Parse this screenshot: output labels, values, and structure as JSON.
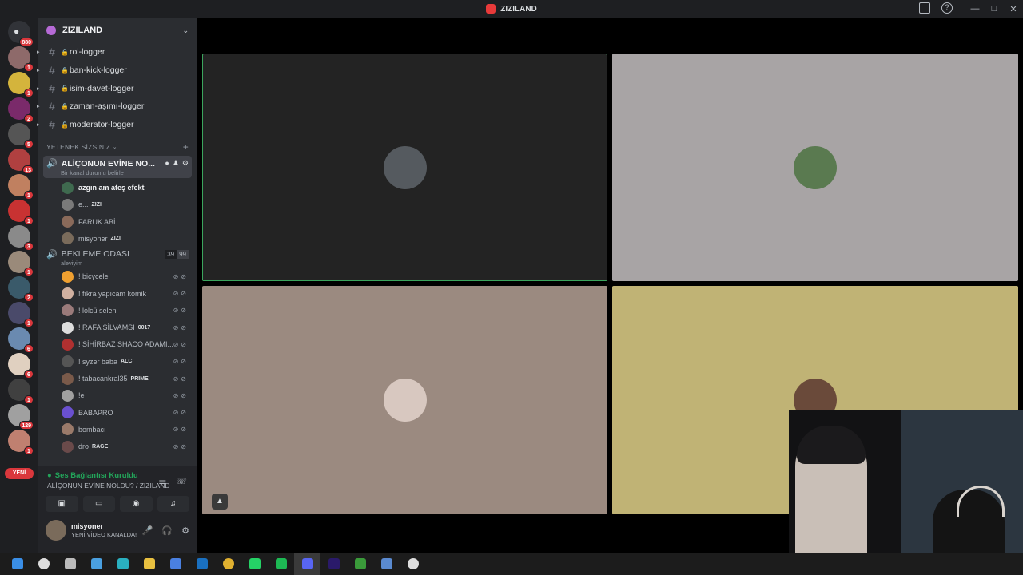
{
  "window": {
    "title": "ZIZILAND"
  },
  "guilds": {
    "home_badge": "880",
    "items": [
      {
        "color": "#8e6a6a",
        "badge": "1"
      },
      {
        "color": "#d4b43c",
        "badge": "1"
      },
      {
        "color": "#7a2a6a",
        "badge": "2"
      },
      {
        "color": "#555555",
        "badge": "5"
      },
      {
        "color": "#b04040",
        "badge": "13"
      },
      {
        "color": "#c08060",
        "badge": "1"
      },
      {
        "color": "#c83232",
        "badge": "1"
      },
      {
        "color": "#8a8a8a",
        "badge": "3"
      },
      {
        "color": "#9a8a7a",
        "badge": "1"
      },
      {
        "color": "#3a5a6a",
        "badge": "2"
      },
      {
        "color": "#4a4a6a",
        "badge": "1"
      },
      {
        "color": "#6a8ab0",
        "badge": "6"
      },
      {
        "color": "#e0d0c0",
        "badge": "6"
      },
      {
        "color": "#404040",
        "badge": "1"
      },
      {
        "color": "#a0a0a0",
        "badge": "129"
      },
      {
        "color": "#c08070",
        "badge": "1"
      }
    ],
    "new_label": "YENİ"
  },
  "server": {
    "name": "ZIZILAND",
    "text_channels": [
      {
        "name": "rol-logger"
      },
      {
        "name": "ban-kick-logger"
      },
      {
        "name": "isim-davet-logger"
      },
      {
        "name": "zaman-aşımı-logger"
      },
      {
        "name": "moderator-logger"
      }
    ],
    "category": "YETENEK SİZSİNİZ",
    "active_voice": {
      "name": "ALİÇONUN EVİNE NO...",
      "status": "Bir kanal durumu belirle",
      "users": [
        {
          "name": "azgın am ateş efekt",
          "tag": "",
          "color": "#3f6a4f"
        },
        {
          "name": "e...",
          "tag": "ZIZI",
          "color": "#7a7a7a"
        },
        {
          "name": "FARUK ABİ",
          "tag": "",
          "color": "#8a6a5a"
        },
        {
          "name": "misyoner",
          "tag": "ZIZI",
          "color": "#7a6b5b"
        }
      ]
    },
    "waiting_voice": {
      "name": "BEKLEME ODASI",
      "count_a": "39",
      "count_b": "99",
      "status": "aleviyim",
      "users": [
        {
          "name": "! bicycele",
          "tag": "",
          "color": "#f0a030"
        },
        {
          "name": "! fıkra yapıcam komik",
          "tag": "",
          "color": "#d0b0a0"
        },
        {
          "name": "! lolcü selen",
          "tag": "",
          "color": "#9a7a7a"
        },
        {
          "name": "! RAFA SİLVAMSI",
          "tag": "0017",
          "color": "#dddddd"
        },
        {
          "name": "! SİHİRBAZ SHACO ADAMI...",
          "tag": "",
          "color": "#b03030"
        },
        {
          "name": "! syzer baba",
          "tag": "ALC",
          "color": "#555555"
        },
        {
          "name": "! tabacankral35",
          "tag": "PRIME",
          "color": "#7a5a4a"
        },
        {
          "name": "!e",
          "tag": "",
          "color": "#a0a0a0"
        },
        {
          "name": "BABAPRO",
          "tag": "",
          "color": "#6a50d0"
        },
        {
          "name": "bombacı",
          "tag": "",
          "color": "#9a7a6a"
        },
        {
          "name": "dro",
          "tag": "RAGE",
          "color": "#6a4a4a"
        }
      ]
    }
  },
  "voice_panel": {
    "state": "Ses Bağlantısı Kuruldu",
    "location": "ALİÇONUN EVİNE NOLDU? / ZIZILAND"
  },
  "user_panel": {
    "name": "misyoner",
    "status": "YENİ VİDEO KANALDA!"
  },
  "tiles": [
    {
      "bg": "#232323",
      "pfp": "#555a5f"
    },
    {
      "bg": "#a8a4a5",
      "pfp": "#5a7a50"
    },
    {
      "bg": "#9b8a80",
      "pfp": "#d8c8c0"
    },
    {
      "bg": "#c0b375",
      "pfp": "#6a4a3a"
    }
  ],
  "taskbar": [
    {
      "name": "windows-start",
      "color": "#3a8ee6"
    },
    {
      "name": "search",
      "color": "#dddddd"
    },
    {
      "name": "task-view",
      "color": "#bbbbbb"
    },
    {
      "name": "copilot",
      "color": "#4aa0e0"
    },
    {
      "name": "edge",
      "color": "#2ab0c0"
    },
    {
      "name": "explorer",
      "color": "#e8c040"
    },
    {
      "name": "store",
      "color": "#4a80e0"
    },
    {
      "name": "outlook",
      "color": "#1a70c0"
    },
    {
      "name": "chrome",
      "color": "#e0b030"
    },
    {
      "name": "whatsapp",
      "color": "#25d366"
    },
    {
      "name": "spotify",
      "color": "#1db954"
    },
    {
      "name": "discord",
      "color": "#5865f2"
    },
    {
      "name": "premiere",
      "color": "#2a1a6a"
    },
    {
      "name": "xbox",
      "color": "#3a9a3a"
    },
    {
      "name": "app-blue",
      "color": "#5a8ad0"
    },
    {
      "name": "obs",
      "color": "#dddddd"
    }
  ]
}
